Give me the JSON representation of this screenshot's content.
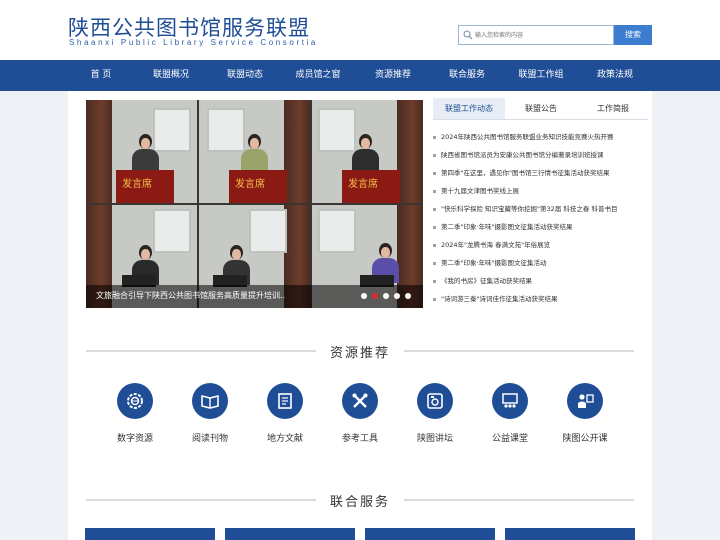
{
  "header": {
    "title_cn": "陕西公共图书馆服务联盟",
    "title_en": "Shaanxi Public Library Service Consortia",
    "search_placeholder": "输入您检索的内容",
    "search_button": "搜索",
    "search_icon": "search-icon"
  },
  "nav": {
    "items": [
      {
        "label": "首 页"
      },
      {
        "label": "联盟概况"
      },
      {
        "label": "联盟动态"
      },
      {
        "label": "成员馆之窗"
      },
      {
        "label": "资源推荐"
      },
      {
        "label": "联合服务"
      },
      {
        "label": "联盟工作组"
      },
      {
        "label": "政策法规"
      }
    ]
  },
  "slider": {
    "caption": "文旅融合引导下陕西公共图书馆服务高质量提升培训...",
    "podium_text": "发言席",
    "total_slides": 5,
    "active_slide": 2
  },
  "news": {
    "tabs": [
      {
        "label": "联盟工作动态",
        "active": true
      },
      {
        "label": "联盟公告",
        "active": false
      },
      {
        "label": "工作简报",
        "active": false
      }
    ],
    "items": [
      "2024年陕西公共图书馆服务联盟业务知识技能竞赛火热开赛",
      "陕西省图书馆派员为安康公共图书馆分编著录培训班授课",
      "第四季\"在这里，遇见你\"图书馆三行情书征集活动获奖结果",
      "第十九届文津图书奖线上展",
      "\"快乐科学探险 知识宝藏等你挖掘\"第32届 科技之春 科普书目",
      "第二季\"印象·年味\"摄影图文征集活动获奖结果",
      "2024年\"龙腾书海 春满文苑\"年俗展览",
      "第二季\"印象·年味\"摄影图文征集活动",
      "《我的书房》征集活动获奖结果",
      "\"诗词游三秦\"诗词佳作征集活动获奖结果"
    ]
  },
  "resources": {
    "title": "资源推荐",
    "items": [
      {
        "label": "数字资源",
        "icon": "gear-globe-icon"
      },
      {
        "label": "阅读刊物",
        "icon": "open-book-icon"
      },
      {
        "label": "地方文献",
        "icon": "document-icon"
      },
      {
        "label": "参考工具",
        "icon": "tools-icon"
      },
      {
        "label": "陕图讲坛",
        "icon": "video-camera-icon"
      },
      {
        "label": "公益课堂",
        "icon": "classroom-icon"
      },
      {
        "label": "陕图公开课",
        "icon": "teacher-icon"
      }
    ]
  },
  "services": {
    "title": "联合服务"
  },
  "colors": {
    "brand": "#1f4e96",
    "accent": "#3c7dd0",
    "active_dot": "#e02a2a",
    "podium": "#8c1a14"
  }
}
